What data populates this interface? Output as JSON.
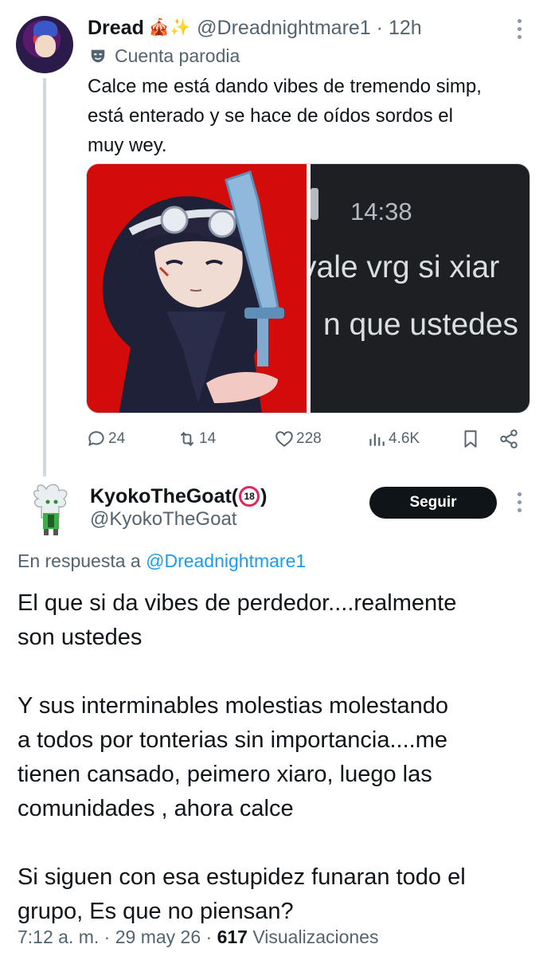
{
  "parent_tweet": {
    "display_name": "Dread",
    "name_emojis": "🎪✨",
    "handle": "@Dreadnightmare1",
    "separator": " · ",
    "time": "12h",
    "parody_label": "Cuenta parodia",
    "text": "Calce me está dando vibes de tremendo simp,\nestá enterado y se hace de oídos sordos el\nmuy wey.",
    "screenshot_image": {
      "time": "14:38",
      "line1": "vale vrg si xiar",
      "line2": "n que ustedes"
    },
    "replies": "24",
    "reposts": "14",
    "likes": "228",
    "views": "4.6K"
  },
  "reply_tweet": {
    "display_name_prefix": "KyokoTheGoat(",
    "badge": "18",
    "display_name_suffix": ")",
    "handle": "@KyokoTheGoat",
    "follow_label": "Seguir",
    "reply_to_prefix": "En respuesta a ",
    "reply_to_handle": "@Dreadnightmare1",
    "text": "El que si da vibes de perdedor....realmente\nson ustedes\n\nY sus interminables molestias molestando\na todos por tonterias sin importancia....me\ntienen cansado, peimero xiaro, luego las\ncomunidades , ahora calce\n\nSi siguen con esa estupidez funaran todo el\ngrupo, Es que no piensan?",
    "time": "7:12 a. m.",
    "separator": " · ",
    "date": "29 may 26",
    "views_count": "617",
    "views_label": " Visualizaciones"
  },
  "colors": {
    "text_primary": "#0f1419",
    "text_secondary": "#536471",
    "link": "#1d9bf0",
    "follow_button": "#0f1419",
    "media_red": "#d40b0b",
    "media_dark": "#1e1f22"
  },
  "icons": [
    "parody-mask-icon",
    "more-options-icon",
    "reply-icon",
    "repost-icon",
    "like-icon",
    "views-icon",
    "bookmark-icon",
    "share-icon"
  ]
}
